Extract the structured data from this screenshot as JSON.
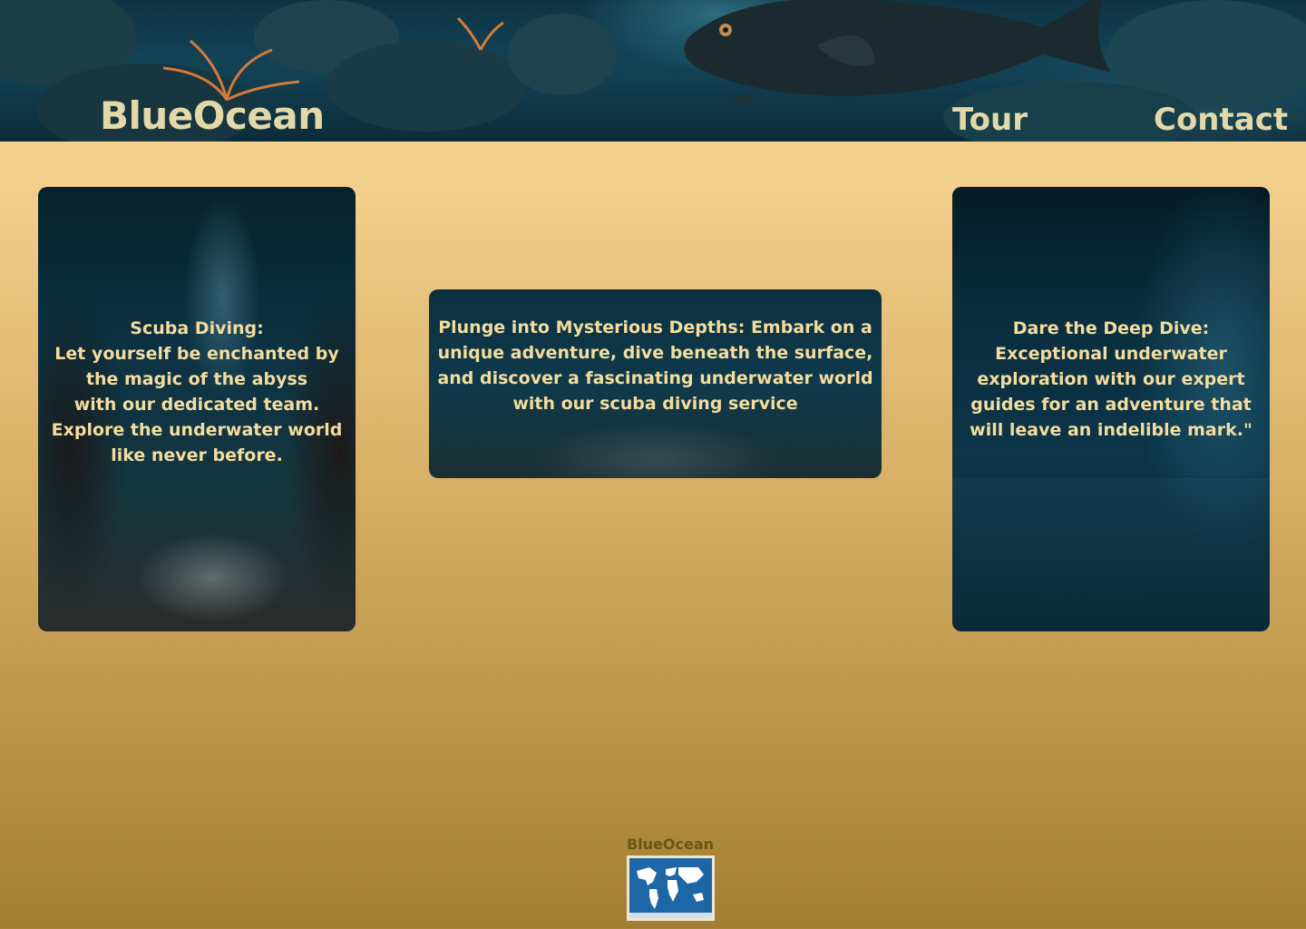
{
  "header": {
    "brand": "BlueOcean",
    "nav": [
      {
        "label": "Tour"
      },
      {
        "label": "Contact"
      }
    ]
  },
  "cards": [
    {
      "text": "Scuba Diving:\nLet yourself be enchanted by\nthe magic of the abyss\nwith our dedicated team.\nExplore the underwater world\nlike never before."
    },
    {
      "text": "Plunge into Mysterious Depths: Embark on a\nunique adventure, dive beneath the surface,\nand discover a fascinating underwater world\nwith our scuba diving service"
    },
    {
      "text": "Dare the Deep Dive:\nExceptional underwater\nexploration with our expert\nguides for an adventure that\nwill leave an indelible mark.\""
    }
  ],
  "footer": {
    "brand": "BlueOcean",
    "map_icon": "world-map-icon"
  },
  "colors": {
    "accent_text": "#e3d8a8",
    "card_text": "#f3dc9e",
    "footer_text": "#6b5612"
  }
}
